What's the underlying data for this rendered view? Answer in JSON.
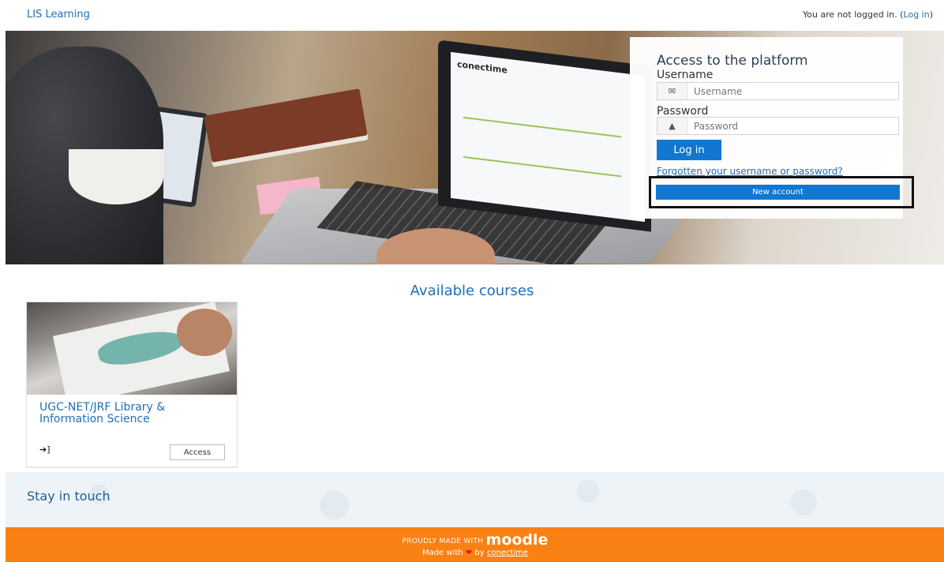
{
  "header": {
    "site_name": "LIS Learning",
    "login_status": "You are not logged in. (",
    "login_link": "Log in",
    "login_status_end": ")"
  },
  "hero": {
    "laptop_brand": "conectime"
  },
  "login_form": {
    "title": "Access to the platform",
    "username_label": "Username",
    "username_placeholder": "Username",
    "password_label": "Password",
    "password_placeholder": "Password",
    "login_button": "Log in",
    "forgot_link": "Forgotten your username or password?",
    "new_account_button": "New account",
    "username_icon": "envelope-icon",
    "password_icon": "lock-icon"
  },
  "courses": {
    "title": "Available courses",
    "items": [
      {
        "name": "UGC-NET/JRF Library & Information Science",
        "access_label": "Access",
        "enrol_icon": "sign-in-icon"
      }
    ]
  },
  "stay_in_touch": {
    "title": "Stay in touch"
  },
  "footer": {
    "made_with_prefix": "PROUDLY MADE WITH",
    "moodle": "moodle",
    "made_with": "Made with",
    "heart": "❤",
    "by": "by",
    "by_link": "conectime"
  },
  "colors": {
    "accent": "#1177d1",
    "link": "#1f6fb5",
    "footer": "#f98012"
  }
}
